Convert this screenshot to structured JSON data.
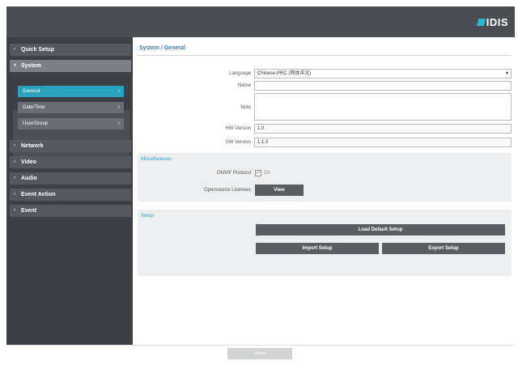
{
  "brand": {
    "logo_text": "IDIS",
    "accent": "#2aa1bd"
  },
  "sidebar": {
    "items": [
      {
        "label": "Quick Setup"
      },
      {
        "label": "System"
      },
      {
        "label": "Network"
      },
      {
        "label": "Video"
      },
      {
        "label": "Audio"
      },
      {
        "label": "Event Action"
      },
      {
        "label": "Event"
      }
    ],
    "system_sub": [
      {
        "label": "General"
      },
      {
        "label": "Date/Time"
      },
      {
        "label": "User/Group"
      }
    ]
  },
  "main": {
    "breadcrumb": "System / General",
    "language_label": "Language",
    "language_value": "Chinese-PRC (简体中文)",
    "name_label": "Name",
    "name_value": "",
    "note_label": "Note",
    "note_value": "",
    "hw_label": "HW Version",
    "hw_value": "1.0",
    "sw_label": "SW Version",
    "sw_value": "1.1.0",
    "misc_title": "Miscellaneous",
    "onvif_label": "ONVIF Protocol",
    "onvif_option": "On",
    "oss_label": "Opensource Licenses",
    "view_button": "View",
    "setup_title": "Setup",
    "load_default_button": "Load Default Setup",
    "import_button": "Import Setup",
    "export_button": "Export Setup"
  },
  "footer": {
    "save_button": "Save"
  }
}
